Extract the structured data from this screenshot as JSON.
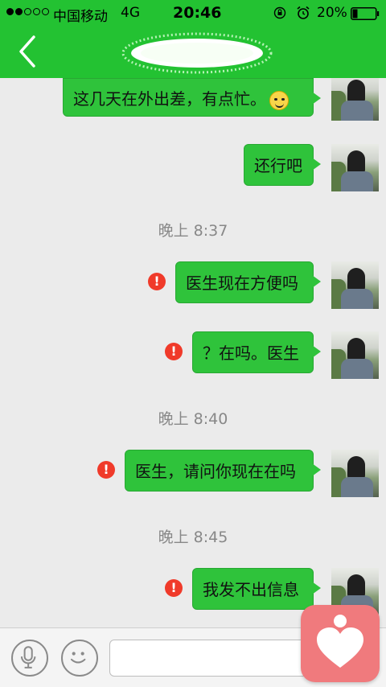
{
  "statusbar": {
    "carrier": "中国移动",
    "network": "4G",
    "time": "20:46",
    "battery_percent": "20%",
    "signal_bars_filled": 2,
    "signal_bars_total": 5,
    "battery_level": 0.2
  },
  "header": {
    "back_icon": "chevron-left-icon"
  },
  "messages": [
    {
      "text": "这几天在外出差，有点忙。",
      "emoji": "smile-emoji"
    },
    {
      "text": "还行吧"
    },
    {
      "timestamp": "晚上 8:37"
    },
    {
      "text": "医生现在方便吗",
      "failed": true
    },
    {
      "text": "？在吗。医生",
      "failed": true
    },
    {
      "timestamp": "晚上 8:40"
    },
    {
      "text": "医生，请问你现在在吗",
      "failed": true
    },
    {
      "timestamp": "晚上 8:45"
    },
    {
      "text": "我发不出信息",
      "failed": true
    }
  ],
  "error_glyph": "!",
  "input": {
    "placeholder": ""
  },
  "colors": {
    "accent": "#23c232",
    "bubble": "#2fc33b",
    "error": "#f03a2a",
    "floating_app": "#f07a7d"
  }
}
